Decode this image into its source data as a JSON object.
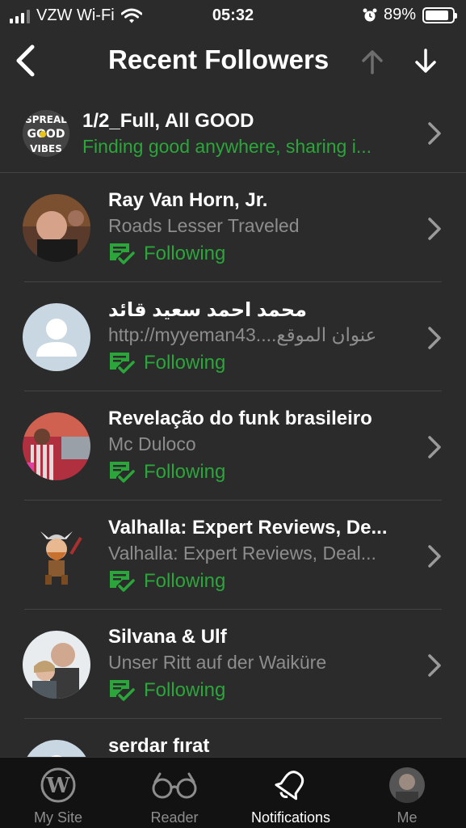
{
  "status_bar": {
    "carrier": "VZW Wi-Fi",
    "time": "05:32",
    "battery": "89%",
    "battery_level": 0.89
  },
  "header": {
    "title": "Recent Followers"
  },
  "top_item": {
    "name": "1/2_Full, All GOOD",
    "description": "Finding good anywhere, sharing i...",
    "avatar_text": [
      "SPREAL",
      "GOOD",
      "VIBES"
    ]
  },
  "followers": [
    {
      "name": "Ray Van Horn, Jr.",
      "site": "Roads Lesser Traveled",
      "status": "Following"
    },
    {
      "name": "محمد احمد سعيد قائد",
      "site": "http://myyeman43....عنوان الموقع",
      "status": "Following"
    },
    {
      "name": "Revelação do funk brasileiro",
      "site": "Mc Duloco",
      "status": "Following"
    },
    {
      "name": "Valhalla: Expert Reviews, De...",
      "site": "Valhalla: Expert Reviews, Deal...",
      "status": "Following"
    },
    {
      "name": "Silvana & Ulf",
      "site": "Unser Ritt auf der Waiküre",
      "status": "Following"
    },
    {
      "name": "serdar fırat",
      "site": "",
      "status": ""
    }
  ],
  "tabs": [
    {
      "label": "My Site",
      "icon": "wordpress-icon"
    },
    {
      "label": "Reader",
      "icon": "glasses-icon"
    },
    {
      "label": "Notifications",
      "icon": "bell-icon"
    },
    {
      "label": "Me",
      "icon": "profile-avatar"
    }
  ],
  "colors": {
    "accent": "#2ba63a",
    "background": "#2b2b2b",
    "tabbar": "#121212",
    "muted": "#8d8d8d"
  }
}
